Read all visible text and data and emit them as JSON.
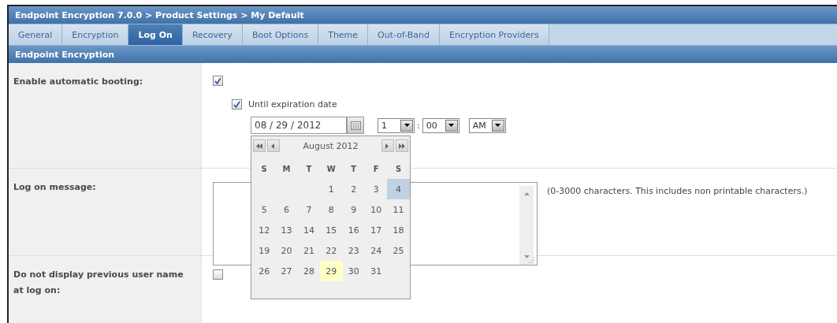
{
  "window": {
    "title": "Endpoint Encryption 7.0.0 > Product Settings > My Default"
  },
  "tabs": [
    {
      "label": "General",
      "selected": false
    },
    {
      "label": "Encryption",
      "selected": false
    },
    {
      "label": "Log On",
      "selected": true
    },
    {
      "label": "Recovery",
      "selected": false
    },
    {
      "label": "Boot Options",
      "selected": false
    },
    {
      "label": "Theme",
      "selected": false
    },
    {
      "label": "Out-of-Band",
      "selected": false
    },
    {
      "label": "Encryption Providers",
      "selected": false
    }
  ],
  "section": {
    "title": "Endpoint Encryption"
  },
  "settings": [
    {
      "kind": "booting",
      "label": "Enable automatic booting:",
      "checked": true,
      "expiration": {
        "label": "Until expiration date",
        "checked": true,
        "date": "08 / 29 / 2012",
        "hour": "1",
        "separator": ":",
        "minute": "00",
        "ampm": "AM"
      },
      "calendar": {
        "month": "August 2012",
        "weekdays": [
          "S",
          "M",
          "T",
          "W",
          "T",
          "F",
          "S"
        ],
        "weeks": [
          [
            {
              "day": "1",
              "selected": false,
              "today": false
            },
            {
              "day": "2",
              "selected": false,
              "today": false
            },
            {
              "day": "3",
              "selected": false,
              "today": false
            },
            {
              "day": "4",
              "selected": false,
              "today": true
            }
          ],
          [
            {
              "day": "5",
              "selected": false,
              "today": false
            },
            {
              "day": "6",
              "selected": false,
              "today": false
            },
            {
              "day": "7",
              "selected": false,
              "today": false
            },
            {
              "day": "8",
              "selected": false,
              "today": false
            },
            {
              "day": "9",
              "selected": false,
              "today": false
            },
            {
              "day": "10",
              "selected": false,
              "today": false
            },
            {
              "day": "11",
              "selected": false,
              "today": false
            }
          ],
          [
            {
              "day": "12",
              "selected": false,
              "today": false
            },
            {
              "day": "13",
              "selected": false,
              "today": false
            },
            {
              "day": "14",
              "selected": false,
              "today": false
            },
            {
              "day": "15",
              "selected": false,
              "today": false
            },
            {
              "day": "16",
              "selected": false,
              "today": false
            },
            {
              "day": "17",
              "selected": false,
              "today": false
            },
            {
              "day": "18",
              "selected": false,
              "today": false
            }
          ],
          [
            {
              "day": "19",
              "selected": false,
              "today": false
            },
            {
              "day": "20",
              "selected": false,
              "today": false
            },
            {
              "day": "21",
              "selected": false,
              "today": false
            },
            {
              "day": "22",
              "selected": false,
              "today": false
            },
            {
              "day": "23",
              "selected": false,
              "today": false
            },
            {
              "day": "24",
              "selected": false,
              "today": false
            },
            {
              "day": "25",
              "selected": false,
              "today": false
            }
          ],
          [
            {
              "day": "26",
              "selected": false,
              "today": false
            },
            {
              "day": "27",
              "selected": false,
              "today": false
            },
            {
              "day": "28",
              "selected": false,
              "today": false
            },
            {
              "day": "29",
              "selected": true,
              "today": false
            },
            {
              "day": "30",
              "selected": false,
              "today": false
            },
            {
              "day": "31",
              "selected": false,
              "today": false
            }
          ]
        ]
      }
    },
    {
      "kind": "message",
      "label": "Log on message:",
      "hint": "(0-3000 characters. This includes non printable characters.)"
    },
    {
      "kind": "checkbox",
      "label": "Do not display previous user name at log on:",
      "checked": false
    }
  ]
}
